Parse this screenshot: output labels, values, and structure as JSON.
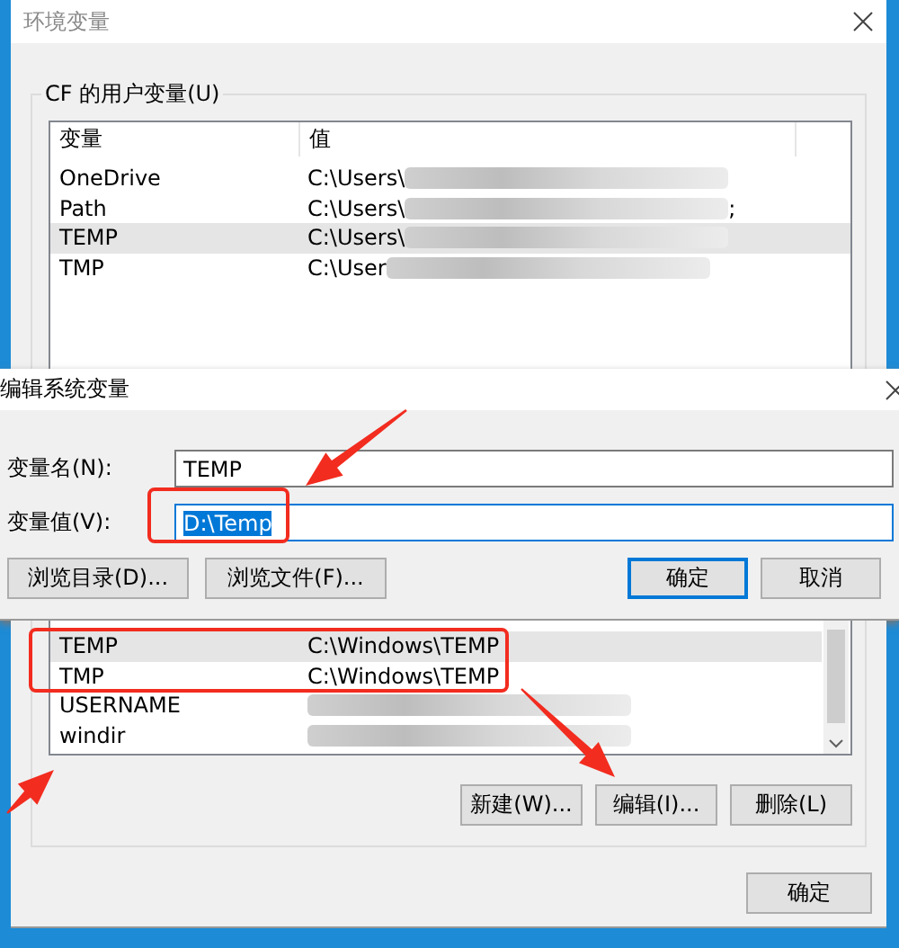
{
  "window": {
    "title": "环境变量"
  },
  "user_variables": {
    "label": "CF 的用户变量(U)",
    "columns": [
      "变量",
      "值"
    ],
    "rows": [
      {
        "name": "OneDrive",
        "value": "C:\\Users\\",
        "redacted": true,
        "selected": false
      },
      {
        "name": "Path",
        "value": "C:\\Users\\",
        "value_tail": ";",
        "redacted": true,
        "selected": false
      },
      {
        "name": "TEMP",
        "value": "C:\\Users\\",
        "redacted": true,
        "selected": true
      },
      {
        "name": "TMP",
        "value": "C:\\User",
        "redacted": true,
        "selected": false
      }
    ]
  },
  "edit_dialog": {
    "title": "编辑系统变量",
    "fields": [
      {
        "label": "变量名(N):",
        "value": "TEMP",
        "focused": false
      },
      {
        "label": "变量值(V):",
        "value": "D:\\Temp",
        "focused": true
      }
    ],
    "buttons": [
      {
        "label": "浏览目录(D)...",
        "default": false
      },
      {
        "label": "浏览文件(F)...",
        "default": false
      },
      {
        "label": "确定",
        "default": true
      },
      {
        "label": "取消",
        "default": false
      }
    ]
  },
  "system_variables": {
    "rows": [
      {
        "name": "TEMP",
        "value": "C:\\Windows\\TEMP",
        "redacted": false,
        "selected": true
      },
      {
        "name": "TMP",
        "value": "C:\\Windows\\TEMP",
        "redacted": false,
        "selected": false
      },
      {
        "name": "USERNAME",
        "redacted": true,
        "selected": false
      },
      {
        "name": "windir",
        "redacted": true,
        "selected": false
      }
    ],
    "buttons": [
      "新建(W)...",
      "编辑(I)...",
      "删除(L)"
    ]
  },
  "dialog_buttons": [
    "确定"
  ]
}
